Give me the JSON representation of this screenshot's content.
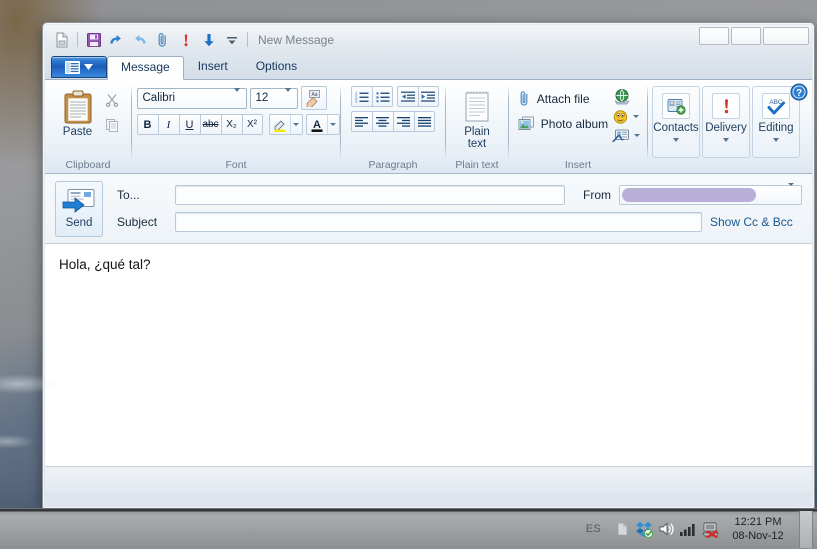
{
  "window": {
    "title": "New Message",
    "controls": {
      "minimize": "minimize-button",
      "maximize": "maximize-button",
      "close": "close-button"
    },
    "help_tooltip": "Help"
  },
  "quick_access": {
    "items": [
      {
        "name": "new-message-icon",
        "label": "New message"
      },
      {
        "name": "save-icon",
        "label": "Save"
      },
      {
        "name": "undo-icon",
        "label": "Undo"
      },
      {
        "name": "redo-icon",
        "label": "Redo"
      },
      {
        "name": "attach-icon",
        "label": "Attach"
      },
      {
        "name": "priority-icon",
        "label": "Priority"
      },
      {
        "name": "send-receive-icon",
        "label": "Send and receive"
      },
      {
        "name": "customize-icon",
        "label": "Customize Quick Access Toolbar"
      }
    ]
  },
  "tabs": [
    {
      "label": "Message",
      "active": true
    },
    {
      "label": "Insert",
      "active": false
    },
    {
      "label": "Options",
      "active": false
    }
  ],
  "ribbon": {
    "groups": [
      {
        "label": "Clipboard",
        "paste": "Paste",
        "cut": "Cut",
        "copy": "Copy"
      },
      {
        "label": "Font",
        "font_family": "Calibri",
        "font_size": "12",
        "clear_formatting": "Clear formatting",
        "bold": "B",
        "italic": "I",
        "underline": "U",
        "strikethrough": "abc",
        "subscript": "X₂",
        "superscript": "X²",
        "highlight": "Text highlight color",
        "font_color": "Font color"
      },
      {
        "label": "Paragraph",
        "numbered_list": "Numbering",
        "bulleted_list": "Bullets",
        "decrease_indent": "Decrease indent",
        "increase_indent": "Increase indent",
        "align_left": "Align left",
        "align_center": "Center",
        "align_right": "Align right",
        "justify": "Justify"
      },
      {
        "label": "Plain text",
        "plain_text_line1": "Plain",
        "plain_text_line2": "text"
      },
      {
        "label": "Insert",
        "attach_file": "Attach file",
        "photo_album": "Photo album",
        "hyperlink": "Hyperlink",
        "emoji": "Emoticons",
        "signature": "Signature"
      }
    ],
    "right_buttons": [
      {
        "label": "Contacts",
        "icon": "contacts-icon",
        "has_menu": true
      },
      {
        "label": "Delivery",
        "icon": "delivery-icon",
        "has_menu": true
      },
      {
        "label": "Editing",
        "icon": "editing-icon",
        "has_menu": true
      }
    ]
  },
  "compose": {
    "send_label": "Send",
    "to_label": "To...",
    "to_value": "",
    "subject_label": "Subject",
    "subject_value": "",
    "from_label": "From",
    "from_value": "",
    "show_cc_bcc": "Show Cc & Bcc",
    "body_text": "Hola, ¿qué tal?"
  },
  "taskbar": {
    "language": "ES",
    "tray": [
      {
        "name": "show-hidden-icons-icon"
      },
      {
        "name": "dropbox-icon"
      },
      {
        "name": "volume-icon"
      },
      {
        "name": "network-signal-icon"
      },
      {
        "name": "network-disconnected-icon"
      }
    ],
    "time": "12:21 PM",
    "date": "08-Nov-12"
  },
  "colors": {
    "accent": "#1a5ab4",
    "link": "#19558f",
    "redaction": "#b9b0d8",
    "taskbar": "#a9acae"
  }
}
